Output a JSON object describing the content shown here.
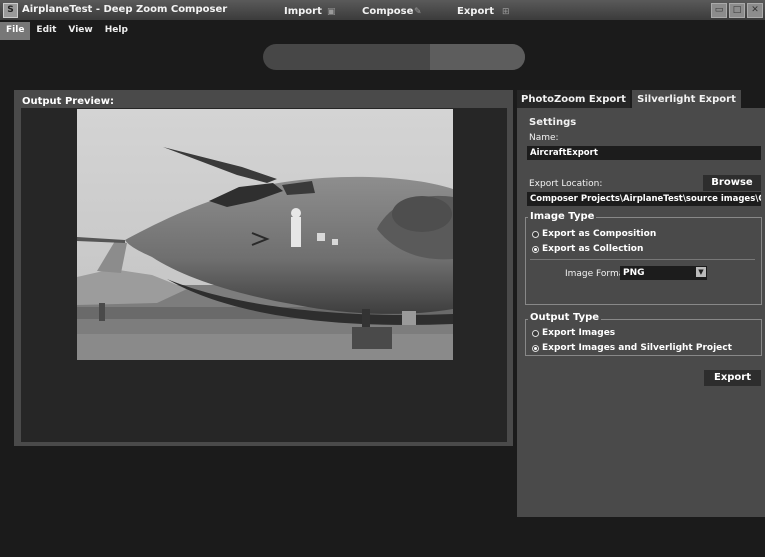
{
  "window": {
    "title": "AirplaneTest - Deep Zoom Composer",
    "app_icon": "S",
    "buttons": [
      "▭",
      "□",
      "✕"
    ]
  },
  "menu": {
    "items": [
      "File",
      "Edit",
      "View",
      "Help"
    ]
  },
  "workflow": {
    "import_label": "Import",
    "compose_label": "Compose",
    "export_label": "Export"
  },
  "preview": {
    "label": "Output Preview:"
  },
  "tabs": {
    "photozoom": "PhotoZoom Export",
    "silverlight": "Silverlight Export"
  },
  "settings": {
    "heading": "Settings",
    "name_label": "Name:",
    "name_value": "AircraftExport",
    "location_label": "Export Location:",
    "browse_label": "Browse",
    "location_value": "Composer Projects\\AirplaneTest\\source images\\OutputSdi"
  },
  "image_type": {
    "title": "Image Type",
    "option_composition": "Export as Composition",
    "option_collection": "Export as Collection",
    "format_label": "Image Format:",
    "format_value": "PNG"
  },
  "output_type": {
    "title": "Output Type",
    "option_images": "Export Images",
    "option_project": "Export Images and Silverlight Project"
  },
  "export_button": "Export"
}
